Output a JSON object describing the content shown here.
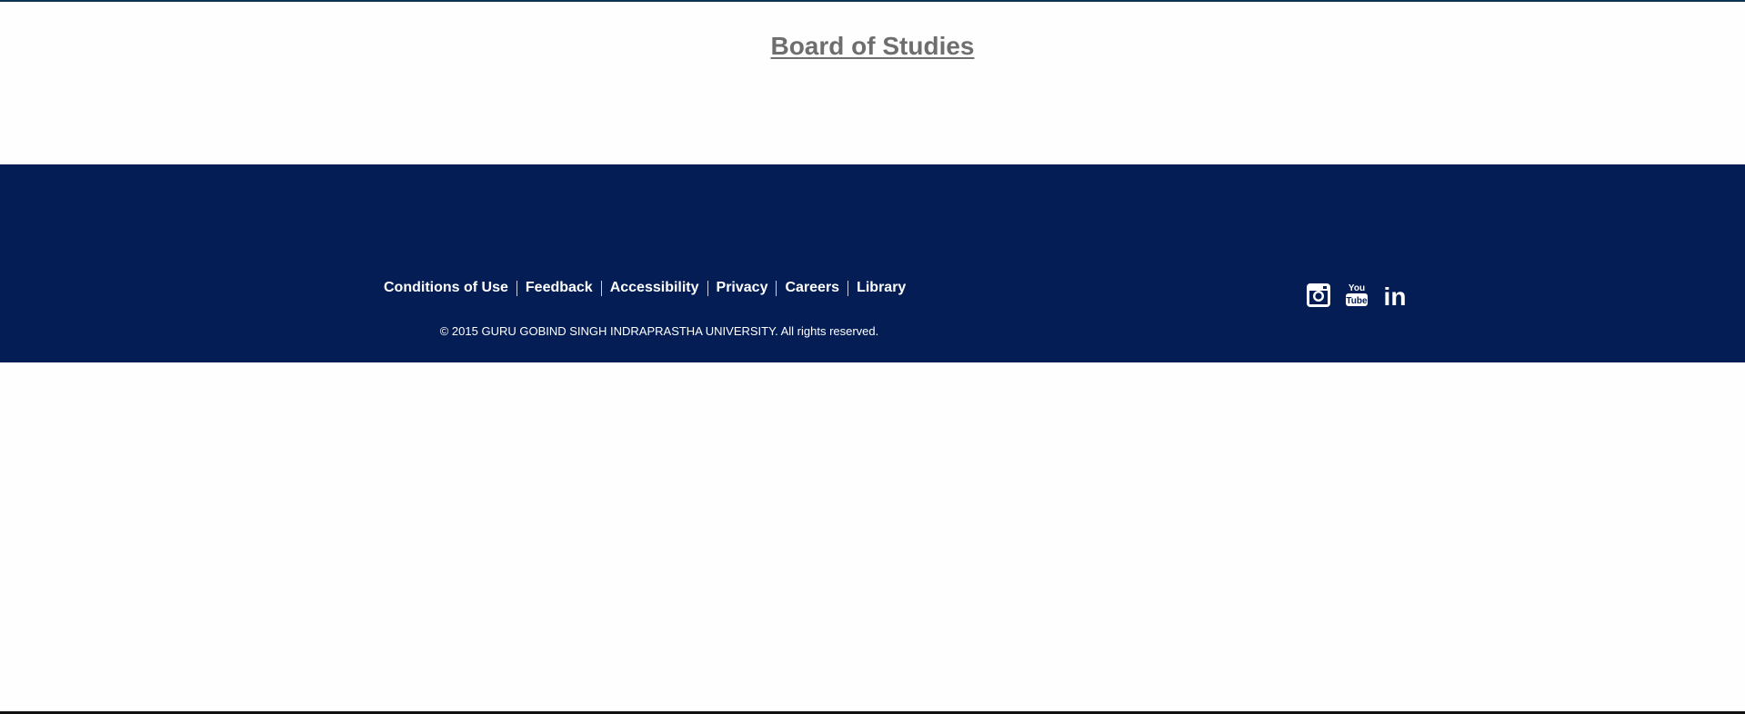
{
  "page": {
    "title": "Board of Studies"
  },
  "footer": {
    "links": [
      {
        "label": "Conditions of Use"
      },
      {
        "label": "Feedback"
      },
      {
        "label": "Accessibility"
      },
      {
        "label": "Privacy"
      },
      {
        "label": "Careers"
      },
      {
        "label": "Library"
      }
    ],
    "copyright": "© 2015 GURU GOBIND SINGH INDRAPRASTHA UNIVERSITY. All rights reserved.",
    "social": [
      {
        "icon": "instagram-icon"
      },
      {
        "icon": "youtube-icon",
        "text_top": "You",
        "text_bottom": "Tube"
      },
      {
        "icon": "linkedin-icon",
        "text": "in"
      }
    ]
  },
  "colors": {
    "footer_bg": "#041e55",
    "title_text": "#6e6e6e",
    "footer_text": "#ffffff"
  }
}
